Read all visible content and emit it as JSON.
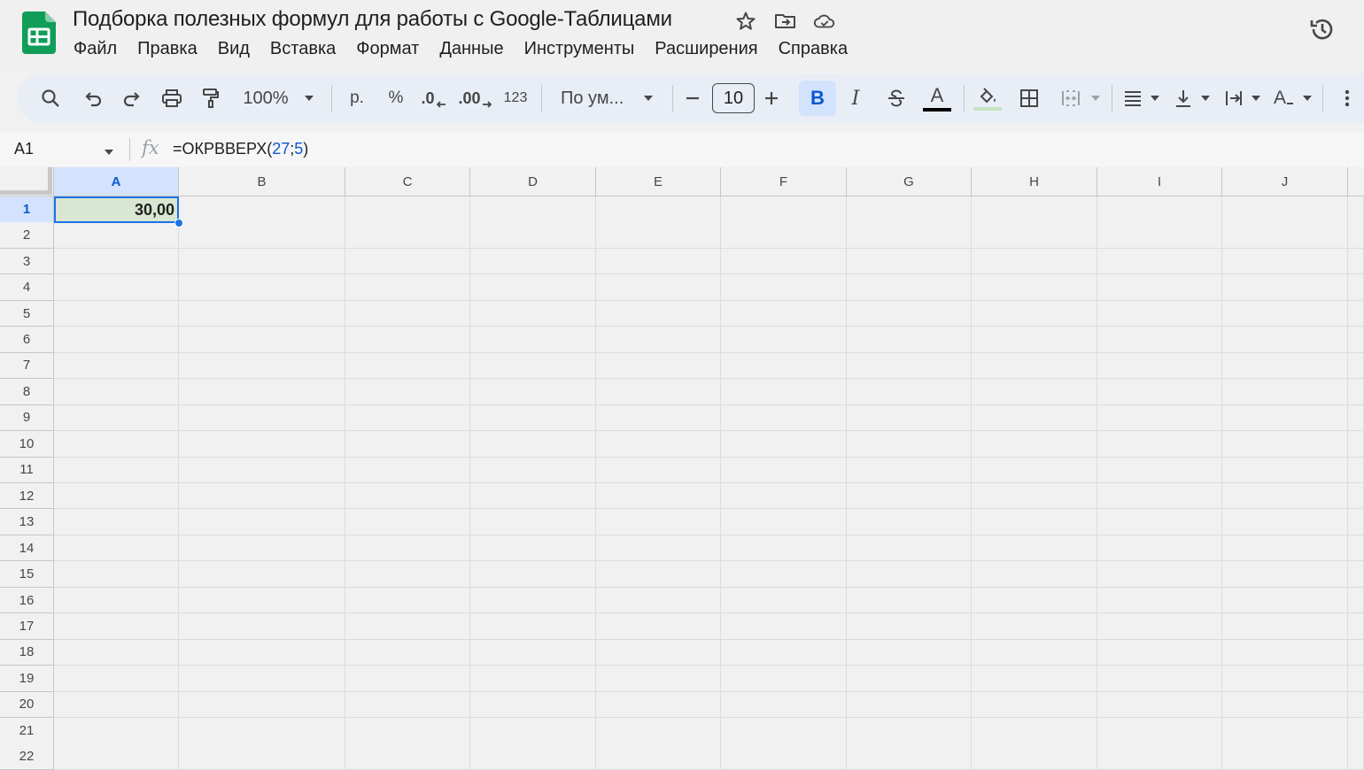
{
  "document": {
    "title": "Подборка полезных формул для работы с Google-Таблицами"
  },
  "menu": {
    "items": [
      "Файл",
      "Правка",
      "Вид",
      "Вставка",
      "Формат",
      "Данные",
      "Инструменты",
      "Расширения",
      "Справка"
    ]
  },
  "toolbar": {
    "zoom": "100%",
    "currency": "р.",
    "percent": "%",
    "decrease_decimal": ".0",
    "increase_decimal": ".00",
    "number_format": "123",
    "font_name": "По ум...",
    "font_size": "10",
    "bold": "B",
    "italic": "I",
    "text_color_label": "A",
    "text_rotation_label": "A",
    "colors": {
      "active_bg": "#d3e3fd",
      "accent": "#0b57d0",
      "text_color": "#000000",
      "fill_color": "#c6e2c2"
    }
  },
  "formula_bar": {
    "cell_ref": "A1",
    "fx": "fx",
    "formula_prefix": "=ОКРВВЕРХ(",
    "arg1": "27",
    "separator": ";",
    "arg2": "5",
    "formula_suffix": ")"
  },
  "grid": {
    "columns": [
      "A",
      "B",
      "C",
      "D",
      "E",
      "F",
      "G",
      "H",
      "I",
      "J"
    ],
    "rows": [
      "1",
      "2",
      "3",
      "4",
      "5",
      "6",
      "7",
      "8",
      "9",
      "10",
      "11",
      "12",
      "13",
      "14",
      "15",
      "16",
      "17",
      "18",
      "19",
      "20",
      "21",
      "22"
    ],
    "selected_cell": "A1",
    "a1_value": "30,00",
    "a1_fill": "#d9e6d1"
  }
}
